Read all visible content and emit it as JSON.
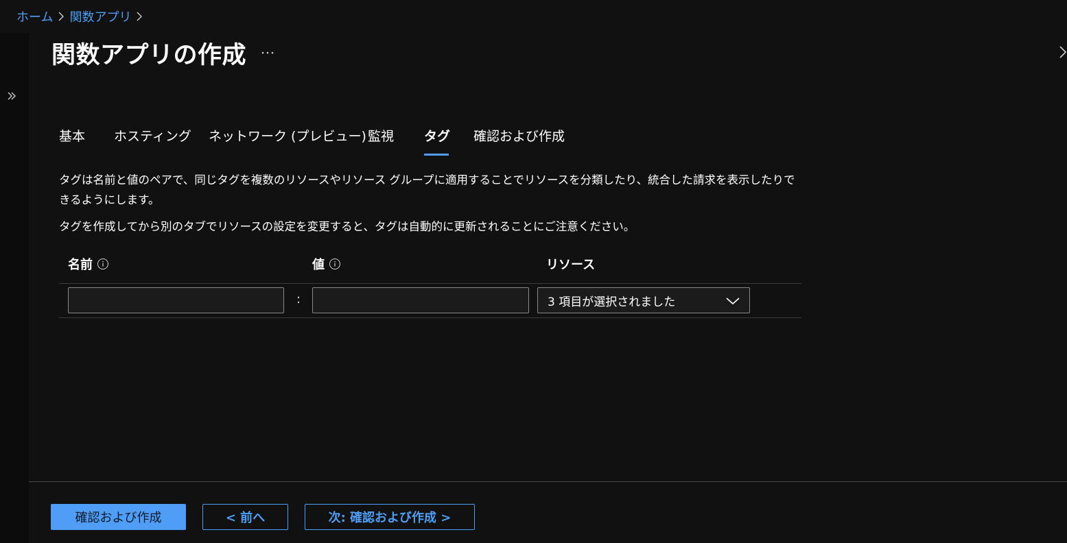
{
  "breadcrumb": {
    "items": [
      "ホーム",
      "関数アプリ"
    ]
  },
  "header": {
    "title": "関数アプリの作成",
    "more_label": "…"
  },
  "tabs": [
    {
      "label": "基本",
      "active": false
    },
    {
      "label": "ホスティング",
      "active": false
    },
    {
      "label": "ネットワーク (プレビュー)",
      "active": false
    },
    {
      "label": "監視",
      "active": false
    },
    {
      "label": "タグ",
      "active": true
    },
    {
      "label": "確認および作成",
      "active": false
    }
  ],
  "content": {
    "description_line1": "タグは名前と値のペアで、同じタグを複数のリソースやリソース グループに適用することでリソースを分類したり、統合した請求を表示したりで",
    "description_line2": "きるようにします。",
    "note": "タグを作成してから別のタブでリソースの設定を変更すると、タグは自動的に更新されることにご注意ください。"
  },
  "tag_table": {
    "columns": {
      "name": "名前",
      "value": "値",
      "resource": "リソース"
    },
    "row": {
      "name_value": "",
      "value_value": "",
      "separator": ":",
      "resource_selected": "3 項目が選択されました"
    }
  },
  "footer": {
    "review_create": "確認および作成",
    "previous": "< 前へ",
    "next": "次: 確認および作成 >"
  },
  "colors": {
    "background": "#111111",
    "accent": "#4f9df7",
    "text": "#ffffff"
  }
}
